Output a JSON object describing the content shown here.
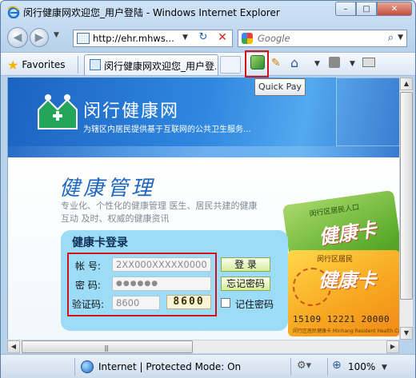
{
  "window": {
    "title": "闵行健康网欢迎您_用户登陆 - Windows Internet Explorer",
    "buttons": {
      "minimize": "–",
      "maximize": "□",
      "close": "✕"
    }
  },
  "address_bar": {
    "url": "http://ehr.mhws...",
    "refresh_glyph": "↻",
    "stop_glyph": "✕"
  },
  "search": {
    "provider_placeholder": "Google",
    "button_glyph": "⌕"
  },
  "favorites_bar": {
    "favorites_label": "Favorites",
    "active_tab_title": "闵行健康网欢迎您_用户登..."
  },
  "toolbar": {
    "quickpay_tooltip": "Quick Pay"
  },
  "page": {
    "site_name": "闵行健康网",
    "slogan": "为辖区内居民提供基于互联网的公共卫生服务...",
    "section_title": "健康管理",
    "description_line1": "专业化、个性化的健康管理   医生、居民共建的健康",
    "description_line2": "互动   及时、权威的健康资讯",
    "login": {
      "title": "健康卡登录",
      "account_label": "帐  号:",
      "account_value": "2XX000XXXXX0000",
      "password_label": "密  码:",
      "password_value": "●●●●●●",
      "captcha_label": "验证码:",
      "captcha_value": "8600",
      "captcha_image_text": "8600",
      "login_button": "登  录",
      "forgot_button": "忘记密码",
      "remember_label": "记住密码"
    },
    "card": {
      "back_header": "闵行区居民人口",
      "back_title": "健康卡",
      "front_header": "闵行区居民",
      "front_title": "健康卡",
      "number": "15109 12221 20000",
      "footer": "闵行区居民健康卡 Minhang Resident Health Card"
    }
  },
  "status_bar": {
    "zone_text": "Internet | Protected Mode: On",
    "zoom": "100%"
  },
  "colors": {
    "accent_blue": "#1f66c2",
    "highlight_red": "#d2111c",
    "login_panel": "#9ddcf7"
  },
  "icons": [
    "ie-logo-icon",
    "back-arrow-icon",
    "forward-arrow-icon",
    "page-icon",
    "refresh-icon",
    "stop-icon",
    "google-icon",
    "search-icon",
    "favorites-star-icon",
    "quickpay-icon",
    "pen-icon",
    "home-icon",
    "rss-icon",
    "print-icon",
    "globe-icon",
    "zoom-icon"
  ]
}
